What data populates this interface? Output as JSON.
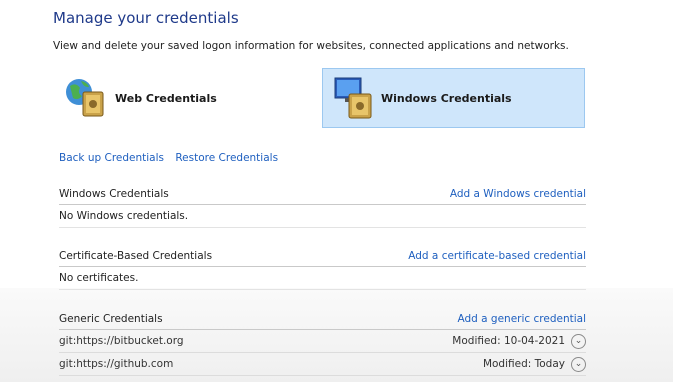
{
  "header": {
    "title": "Manage your credentials",
    "description": "View and delete your saved logon information for websites, connected applications and networks."
  },
  "cards": {
    "web": "Web Credentials",
    "windows": "Windows Credentials"
  },
  "actions": {
    "backup": "Back up Credentials",
    "restore": "Restore Credentials"
  },
  "sections": {
    "windows": {
      "title": "Windows Credentials",
      "add": "Add a Windows credential",
      "empty": "No Windows credentials."
    },
    "certificate": {
      "title": "Certificate-Based Credentials",
      "add": "Add a certificate-based credential",
      "empty": "No certificates."
    },
    "generic": {
      "title": "Generic Credentials",
      "add": "Add a generic credential",
      "items": [
        {
          "name": "git:https://bitbucket.org",
          "modified": "Modified:  10-04-2021"
        },
        {
          "name": "git:https://github.com",
          "modified": "Modified:  Today"
        }
      ]
    }
  },
  "colors": {
    "link": "#1e5fbf",
    "title": "#1f3a8a",
    "selected_card": "#cfe6fb"
  }
}
